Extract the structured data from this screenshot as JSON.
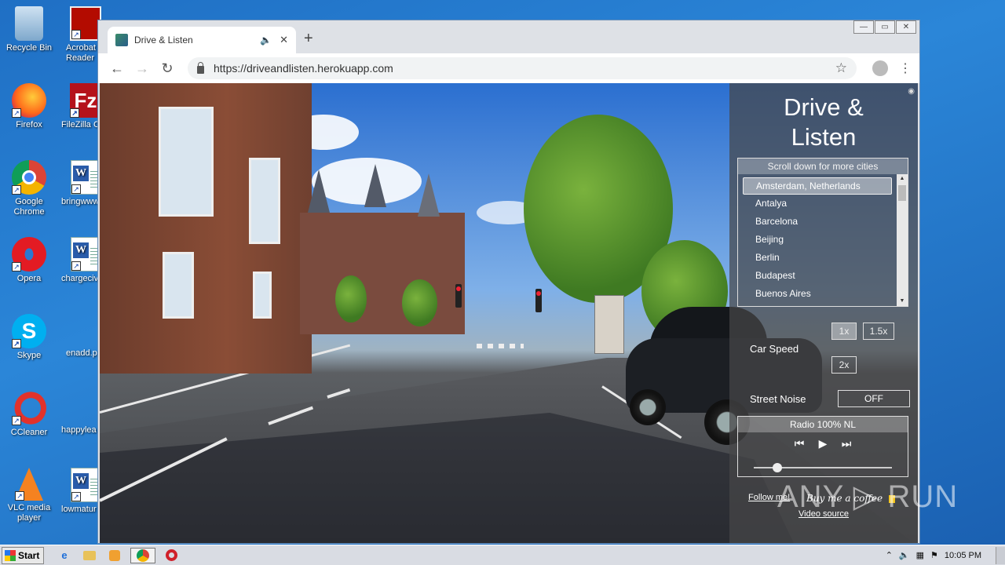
{
  "desktop": {
    "icons": [
      {
        "label": "Recycle Bin"
      },
      {
        "label": "Acrobat Reader"
      },
      {
        "label": "Firefox"
      },
      {
        "label": "FileZilla C"
      },
      {
        "label": "Google Chrome"
      },
      {
        "label": "bringwww"
      },
      {
        "label": "Opera"
      },
      {
        "label": "chargeciv"
      },
      {
        "label": "Skype"
      },
      {
        "label": "enadd.p"
      },
      {
        "label": "CCleaner"
      },
      {
        "label": "happylea"
      },
      {
        "label": "VLC media player"
      },
      {
        "label": "lowmatur"
      }
    ]
  },
  "browser": {
    "tab_title": "Drive & Listen",
    "tab_audio_icon": "🔈",
    "tab_close": "✕",
    "new_tab": "+",
    "url": "https://driveandlisten.herokuapp.com",
    "back": "←",
    "forward": "→",
    "reload": "↻",
    "star": "☆",
    "menu": "⋮",
    "win_min": "—",
    "win_max": "▭",
    "win_close": "✕"
  },
  "app": {
    "title_line1": "Drive &",
    "title_line2": "Listen",
    "eye_icon": "◉",
    "city_header": "Scroll down for more cities",
    "cities": [
      "Amsterdam, Netherlands",
      "Antalya",
      "Barcelona",
      "Beijing",
      "Berlin",
      "Budapest",
      "Buenos Aires"
    ],
    "selected_city": "Amsterdam, Netherlands",
    "car_speed_label": "Car Speed",
    "speed_options": [
      "1x",
      "1.5x",
      "2x"
    ],
    "selected_speed": "1x",
    "street_noise_label": "Street Noise",
    "street_noise_value": "OFF",
    "radio_station": "Radio 100% NL",
    "radio_prev": "⏮",
    "radio_play": "▶",
    "radio_next": "⏭",
    "volume": 0.17,
    "follow_link": "Follow me!",
    "coffee_text": "Buy me a coffee",
    "video_source_link": "Video source"
  },
  "watermark": "ANY ▷ RUN",
  "taskbar": {
    "start_label": "Start",
    "clock": "10:05 PM"
  }
}
